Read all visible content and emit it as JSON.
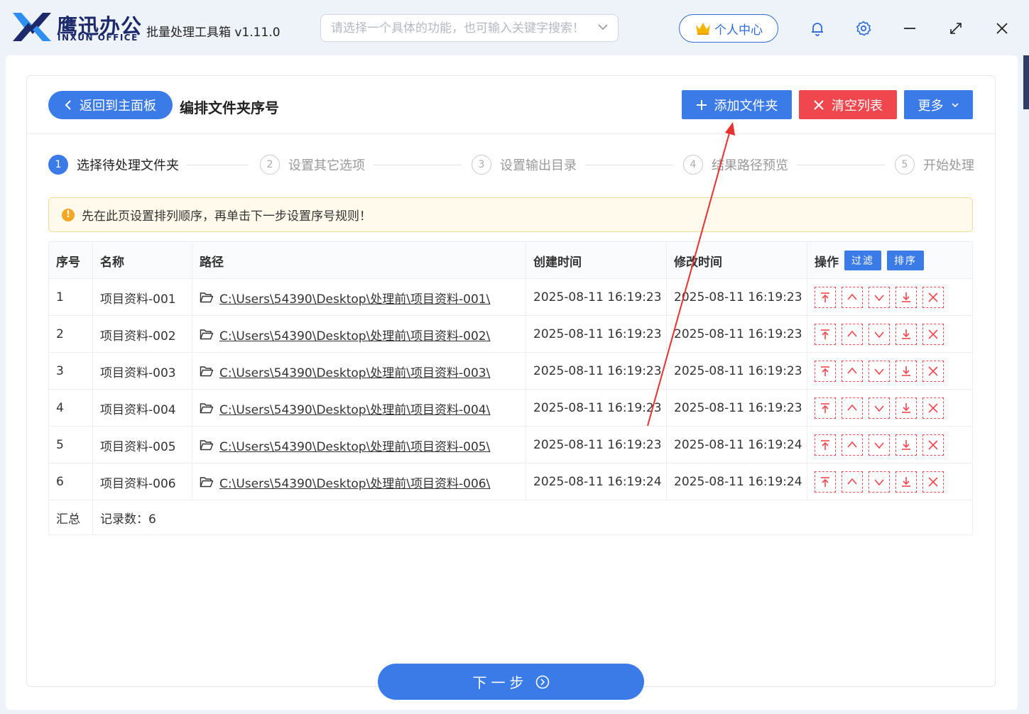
{
  "titlebar": {
    "brand_cn": "鹰迅办公",
    "brand_en": "INXUN OFFICE",
    "app_title": "批量处理工具箱 v1.11.0",
    "search_placeholder": "请选择一个具体的功能，也可输入关键字搜索！",
    "user_center": "个人中心",
    "icons": [
      "bell-icon",
      "gear-icon",
      "minimize-icon",
      "maximize-icon",
      "close-icon"
    ],
    "accent_color": "#3b7be8",
    "danger_color": "#f0474f"
  },
  "header": {
    "back_label": "返回到主面板",
    "page_title": "编排文件夹序号",
    "add_label": "添加文件夹",
    "clear_label": "清空列表",
    "more_label": "更多"
  },
  "steps": [
    {
      "num": "1",
      "label": "选择待处理文件夹"
    },
    {
      "num": "2",
      "label": "设置其它选项"
    },
    {
      "num": "3",
      "label": "设置输出目录"
    },
    {
      "num": "4",
      "label": "结果路径预览"
    },
    {
      "num": "5",
      "label": "开始处理"
    }
  ],
  "notice": "先在此页设置排列顺序，再单击下一步设置序号规则！",
  "table": {
    "columns": {
      "index": "序号",
      "name": "名称",
      "path": "路径",
      "created": "创建时间",
      "modified": "修改时间",
      "ops": "操作",
      "filter": "过滤",
      "sort": "排序"
    },
    "rows": [
      {
        "index": "1",
        "name": "项目资料-001",
        "path": "C:\\Users\\54390\\Desktop\\处理前\\项目资料-001\\",
        "created": "2025-08-11 16:19:23",
        "modified": "2025-08-11 16:19:23"
      },
      {
        "index": "2",
        "name": "项目资料-002",
        "path": "C:\\Users\\54390\\Desktop\\处理前\\项目资料-002\\",
        "created": "2025-08-11 16:19:23",
        "modified": "2025-08-11 16:19:23"
      },
      {
        "index": "3",
        "name": "项目资料-003",
        "path": "C:\\Users\\54390\\Desktop\\处理前\\项目资料-003\\",
        "created": "2025-08-11 16:19:23",
        "modified": "2025-08-11 16:19:23"
      },
      {
        "index": "4",
        "name": "项目资料-004",
        "path": "C:\\Users\\54390\\Desktop\\处理前\\项目资料-004\\",
        "created": "2025-08-11 16:19:23",
        "modified": "2025-08-11 16:19:23"
      },
      {
        "index": "5",
        "name": "项目资料-005",
        "path": "C:\\Users\\54390\\Desktop\\处理前\\项目资料-005\\",
        "created": "2025-08-11 16:19:23",
        "modified": "2025-08-11 16:19:24"
      },
      {
        "index": "6",
        "name": "项目资料-006",
        "path": "C:\\Users\\54390\\Desktop\\处理前\\项目资料-006\\",
        "created": "2025-08-11 16:19:24",
        "modified": "2025-08-11 16:19:24"
      }
    ],
    "summary_label": "汇总",
    "summary_value": "记录数：6"
  },
  "next_label": "下一步"
}
